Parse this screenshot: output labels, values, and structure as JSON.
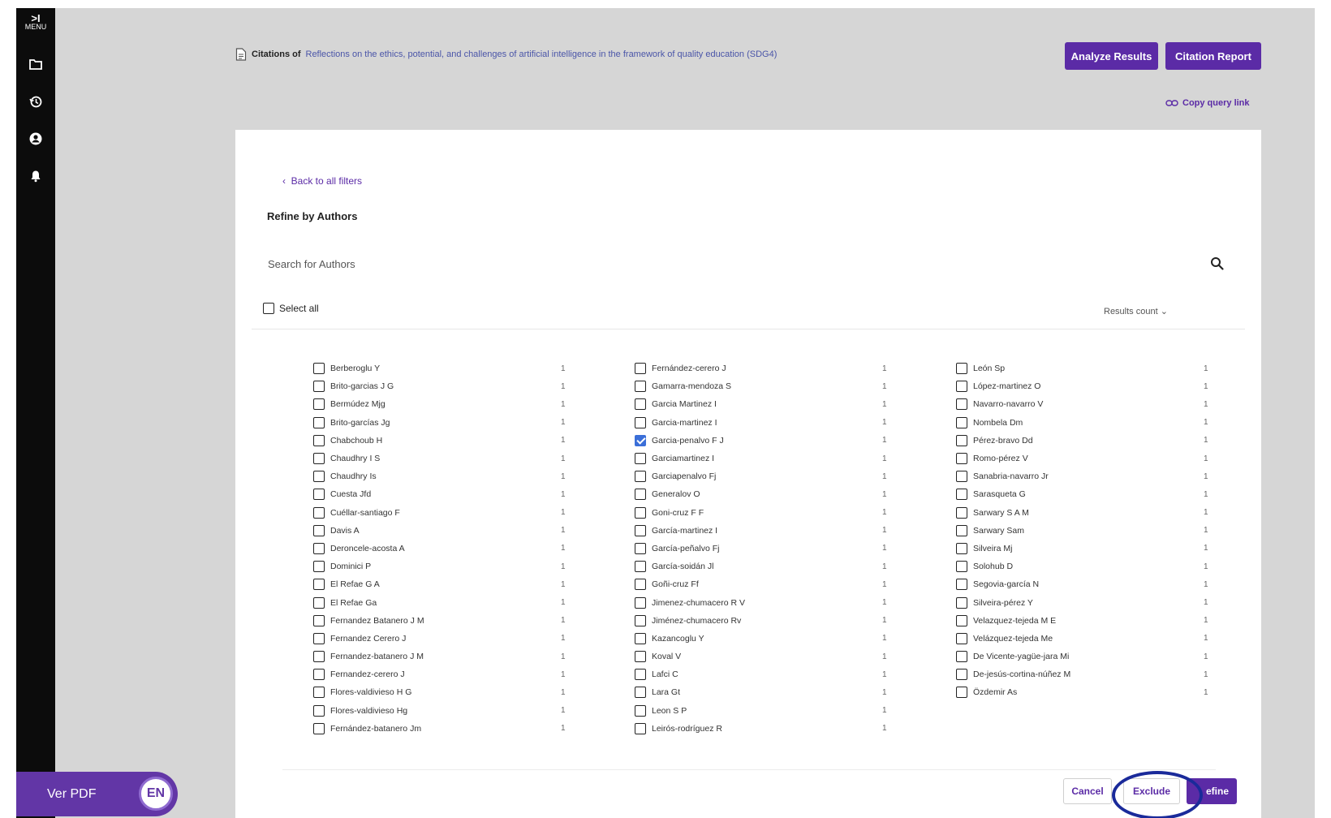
{
  "sidebar": {
    "menu_arrow": ">I",
    "menu_label": "MENU",
    "icons": [
      "folder-icon",
      "history-icon",
      "user-icon",
      "bell-icon"
    ]
  },
  "header": {
    "citations_prefix": "Citations of",
    "citations_title": "Reflections on the ethics, potential, and challenges of artificial intelligence in the framework of quality education (SDG4)",
    "analyze_label": "Analyze Results",
    "citation_report_label": "Citation Report",
    "copy_link_label": "Copy query link"
  },
  "panel": {
    "back_label": "Back to all filters",
    "title": "Refine by Authors",
    "search_placeholder": "Search for Authors",
    "select_all_label": "Select all",
    "results_count_label": "Results count"
  },
  "authors": {
    "col1": [
      {
        "name": "Berberoglu Y",
        "count": "1",
        "checked": false
      },
      {
        "name": "Brito-garcias J G",
        "count": "1",
        "checked": false
      },
      {
        "name": "Bermúdez Mjg",
        "count": "1",
        "checked": false
      },
      {
        "name": "Brito-garcías Jg",
        "count": "1",
        "checked": false
      },
      {
        "name": "Chabchoub H",
        "count": "1",
        "checked": false
      },
      {
        "name": "Chaudhry I S",
        "count": "1",
        "checked": false
      },
      {
        "name": "Chaudhry Is",
        "count": "1",
        "checked": false
      },
      {
        "name": "Cuesta Jfd",
        "count": "1",
        "checked": false
      },
      {
        "name": "Cuéllar-santiago F",
        "count": "1",
        "checked": false
      },
      {
        "name": "Davis A",
        "count": "1",
        "checked": false
      },
      {
        "name": "Deroncele-acosta A",
        "count": "1",
        "checked": false
      },
      {
        "name": "Dominici P",
        "count": "1",
        "checked": false
      },
      {
        "name": "El Refae G A",
        "count": "1",
        "checked": false
      },
      {
        "name": "El Refae Ga",
        "count": "1",
        "checked": false
      },
      {
        "name": "Fernandez Batanero J M",
        "count": "1",
        "checked": false
      },
      {
        "name": "Fernandez Cerero J",
        "count": "1",
        "checked": false
      },
      {
        "name": "Fernandez-batanero J M",
        "count": "1",
        "checked": false
      },
      {
        "name": "Fernandez-cerero J",
        "count": "1",
        "checked": false
      },
      {
        "name": "Flores-valdivieso H G",
        "count": "1",
        "checked": false
      },
      {
        "name": "Flores-valdivieso Hg",
        "count": "1",
        "checked": false
      },
      {
        "name": "Fernández-batanero Jm",
        "count": "1",
        "checked": false
      }
    ],
    "col2": [
      {
        "name": "Fernández-cerero J",
        "count": "1",
        "checked": false
      },
      {
        "name": "Gamarra-mendoza S",
        "count": "1",
        "checked": false
      },
      {
        "name": "Garcia Martinez I",
        "count": "1",
        "checked": false
      },
      {
        "name": "Garcia-martinez I",
        "count": "1",
        "checked": false
      },
      {
        "name": "Garcia-penalvo F J",
        "count": "1",
        "checked": true
      },
      {
        "name": "Garciamartinez I",
        "count": "1",
        "checked": false
      },
      {
        "name": "Garciapenalvo Fj",
        "count": "1",
        "checked": false
      },
      {
        "name": "Generalov O",
        "count": "1",
        "checked": false
      },
      {
        "name": "Goni-cruz F F",
        "count": "1",
        "checked": false
      },
      {
        "name": "García-martinez I",
        "count": "1",
        "checked": false
      },
      {
        "name": "García-peñalvo Fj",
        "count": "1",
        "checked": false
      },
      {
        "name": "García-soidán Jl",
        "count": "1",
        "checked": false
      },
      {
        "name": "Goñi-cruz Ff",
        "count": "1",
        "checked": false
      },
      {
        "name": "Jimenez-chumacero R V",
        "count": "1",
        "checked": false
      },
      {
        "name": "Jiménez-chumacero Rv",
        "count": "1",
        "checked": false
      },
      {
        "name": "Kazancoglu Y",
        "count": "1",
        "checked": false
      },
      {
        "name": "Koval V",
        "count": "1",
        "checked": false
      },
      {
        "name": "Lafci C",
        "count": "1",
        "checked": false
      },
      {
        "name": "Lara Gt",
        "count": "1",
        "checked": false
      },
      {
        "name": "Leon S P",
        "count": "1",
        "checked": false
      },
      {
        "name": "Leirós-rodríguez R",
        "count": "1",
        "checked": false
      }
    ],
    "col3": [
      {
        "name": "León Sp",
        "count": "1",
        "checked": false
      },
      {
        "name": "López-martinez O",
        "count": "1",
        "checked": false
      },
      {
        "name": "Navarro-navarro V",
        "count": "1",
        "checked": false
      },
      {
        "name": "Nombela Dm",
        "count": "1",
        "checked": false
      },
      {
        "name": "Pérez-bravo Dd",
        "count": "1",
        "checked": false
      },
      {
        "name": "Romo-pérez V",
        "count": "1",
        "checked": false
      },
      {
        "name": "Sanabria-navarro Jr",
        "count": "1",
        "checked": false
      },
      {
        "name": "Sarasqueta G",
        "count": "1",
        "checked": false
      },
      {
        "name": "Sarwary S A M",
        "count": "1",
        "checked": false
      },
      {
        "name": "Sarwary Sam",
        "count": "1",
        "checked": false
      },
      {
        "name": "Silveira Mj",
        "count": "1",
        "checked": false
      },
      {
        "name": "Solohub D",
        "count": "1",
        "checked": false
      },
      {
        "name": "Segovia-garcía N",
        "count": "1",
        "checked": false
      },
      {
        "name": "Silveira-pérez Y",
        "count": "1",
        "checked": false
      },
      {
        "name": "Velazquez-tejeda M E",
        "count": "1",
        "checked": false
      },
      {
        "name": "Velázquez-tejeda Me",
        "count": "1",
        "checked": false
      },
      {
        "name": "De Vicente-yagüe-jara Mi",
        "count": "1",
        "checked": false
      },
      {
        "name": "De-jesús-cortina-núñez M",
        "count": "1",
        "checked": false
      },
      {
        "name": "Özdemir As",
        "count": "1",
        "checked": false
      }
    ]
  },
  "footer": {
    "cancel_label": "Cancel",
    "exclude_label": "Exclude",
    "refine_label": "efine"
  },
  "pdf_bar": {
    "label": "Ver PDF",
    "lang": "EN"
  },
  "colors": {
    "accent": "#5b2ba6",
    "checkbox_checked": "#3b6fd8",
    "annotation": "#1a2a9a"
  }
}
